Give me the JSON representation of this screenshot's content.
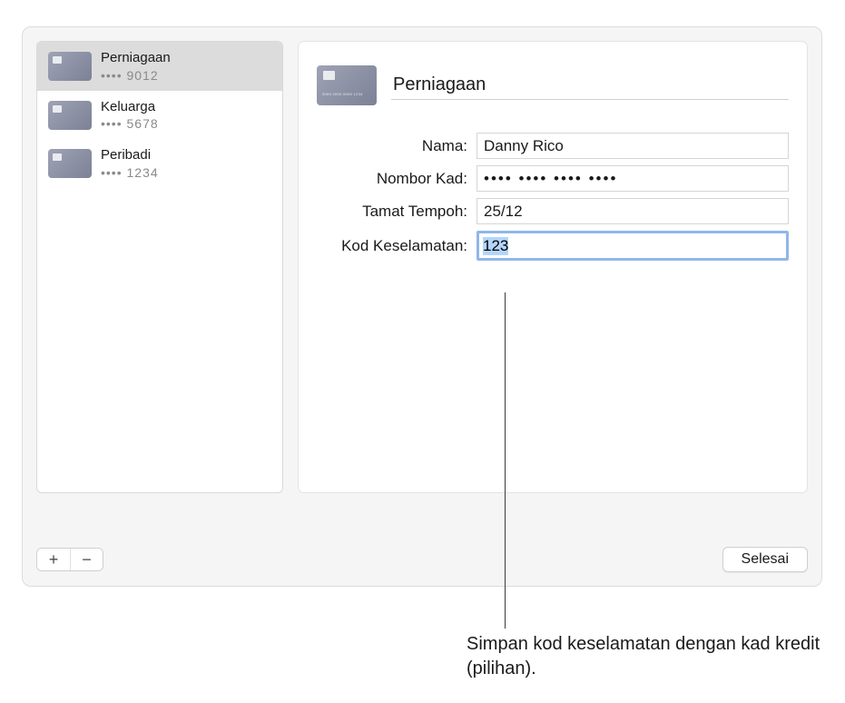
{
  "sidebar": {
    "items": [
      {
        "title": "Perniagaan",
        "sub": "•••• 9012"
      },
      {
        "title": "Keluarga",
        "sub": "•••• 5678"
      },
      {
        "title": "Peribadi",
        "sub": "•••• 1234"
      }
    ]
  },
  "detail": {
    "title_value": "Perniagaan",
    "rows": {
      "name": {
        "label": "Nama:",
        "value": "Danny Rico"
      },
      "number": {
        "label": "Nombor Kad:",
        "value": "•••• •••• •••• ••••"
      },
      "expiry": {
        "label": "Tamat Tempoh:",
        "value": "25/12"
      },
      "security": {
        "label": "Kod Keselamatan:",
        "value": "123"
      }
    }
  },
  "buttons": {
    "add": "+",
    "remove": "−",
    "done": "Selesai"
  },
  "callout": "Simpan kod keselamatan dengan kad kredit (pilihan)."
}
